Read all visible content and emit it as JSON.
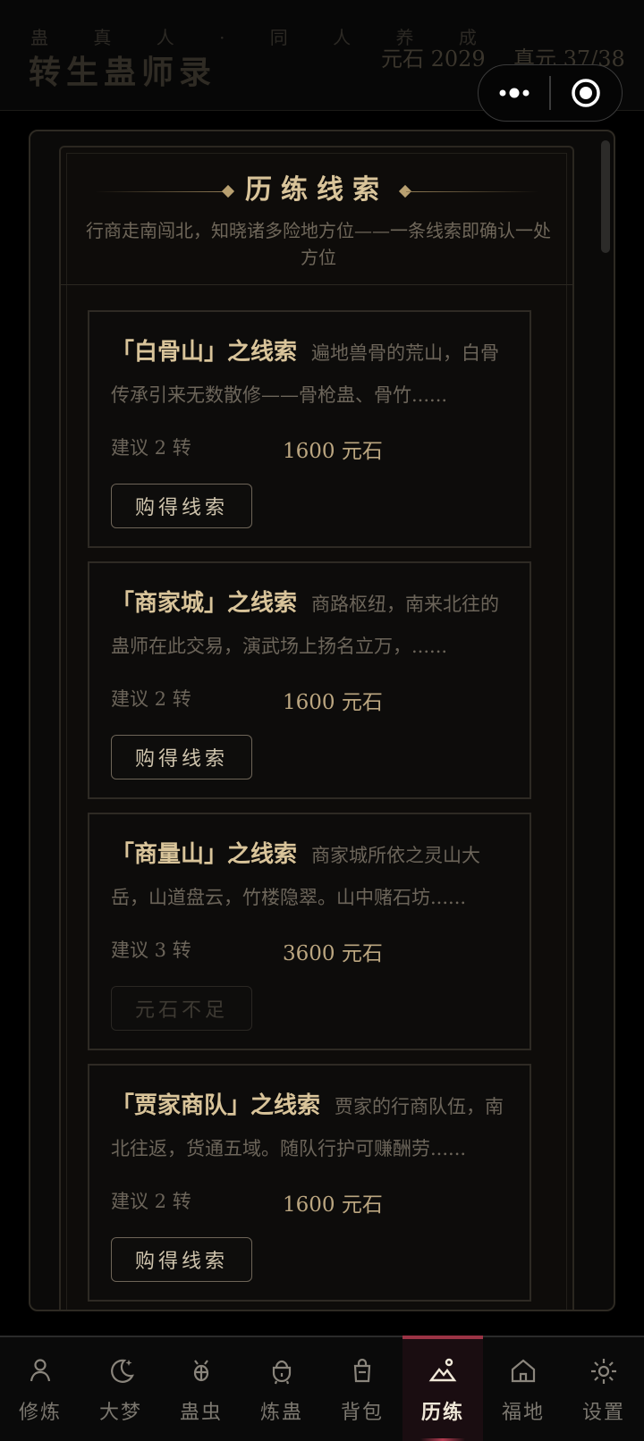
{
  "header": {
    "subtitle": "蛊 真 人 · 同 人 养 成",
    "title": "转生蛊师录",
    "yuanshi": "元石 2029",
    "zhenyuan": "真元 37/38"
  },
  "panel": {
    "title": "历练线索",
    "desc": "行商走南闯北，知晓诸多险地方位——一条线索即确认一处方位"
  },
  "cards": [
    {
      "name": "「白骨山」之线索",
      "desc": "遍地兽骨的荒山，白骨传承引来无数散修——骨枪蛊、骨竹......",
      "req": "建议 2 转",
      "price": "1600 元石",
      "button": "购得线索"
    },
    {
      "name": "「商家城」之线索",
      "desc": "商路枢纽，南来北往的蛊师在此交易，演武场上扬名立万，......",
      "req": "建议 2 转",
      "price": "1600 元石",
      "button": "购得线索"
    },
    {
      "name": "「商量山」之线索",
      "desc": "商家城所依之灵山大岳，山道盘云，竹楼隐翠。山中赌石坊......",
      "req": "建议 3 转",
      "price": "3600 元石",
      "button": "元石不足"
    },
    {
      "name": "「贾家商队」之线索",
      "desc": "贾家的行商队伍，南北往返，货通五域。随队行护可赚酬劳......",
      "req": "建议 2 转",
      "price": "1600 元石",
      "button": "购得线索"
    }
  ],
  "tabs": [
    {
      "label": "修炼",
      "icon": "person-icon"
    },
    {
      "label": "大梦",
      "icon": "moon-icon"
    },
    {
      "label": "蛊虫",
      "icon": "bug-icon"
    },
    {
      "label": "炼蛊",
      "icon": "cauldron-icon"
    },
    {
      "label": "背包",
      "icon": "bag-icon"
    },
    {
      "label": "历练",
      "icon": "mountain-icon"
    },
    {
      "label": "福地",
      "icon": "home-icon"
    },
    {
      "label": "设置",
      "icon": "gear-icon"
    }
  ],
  "colors": {
    "accent": "#d9c49a",
    "active_tab_bar": "#9b3345"
  }
}
